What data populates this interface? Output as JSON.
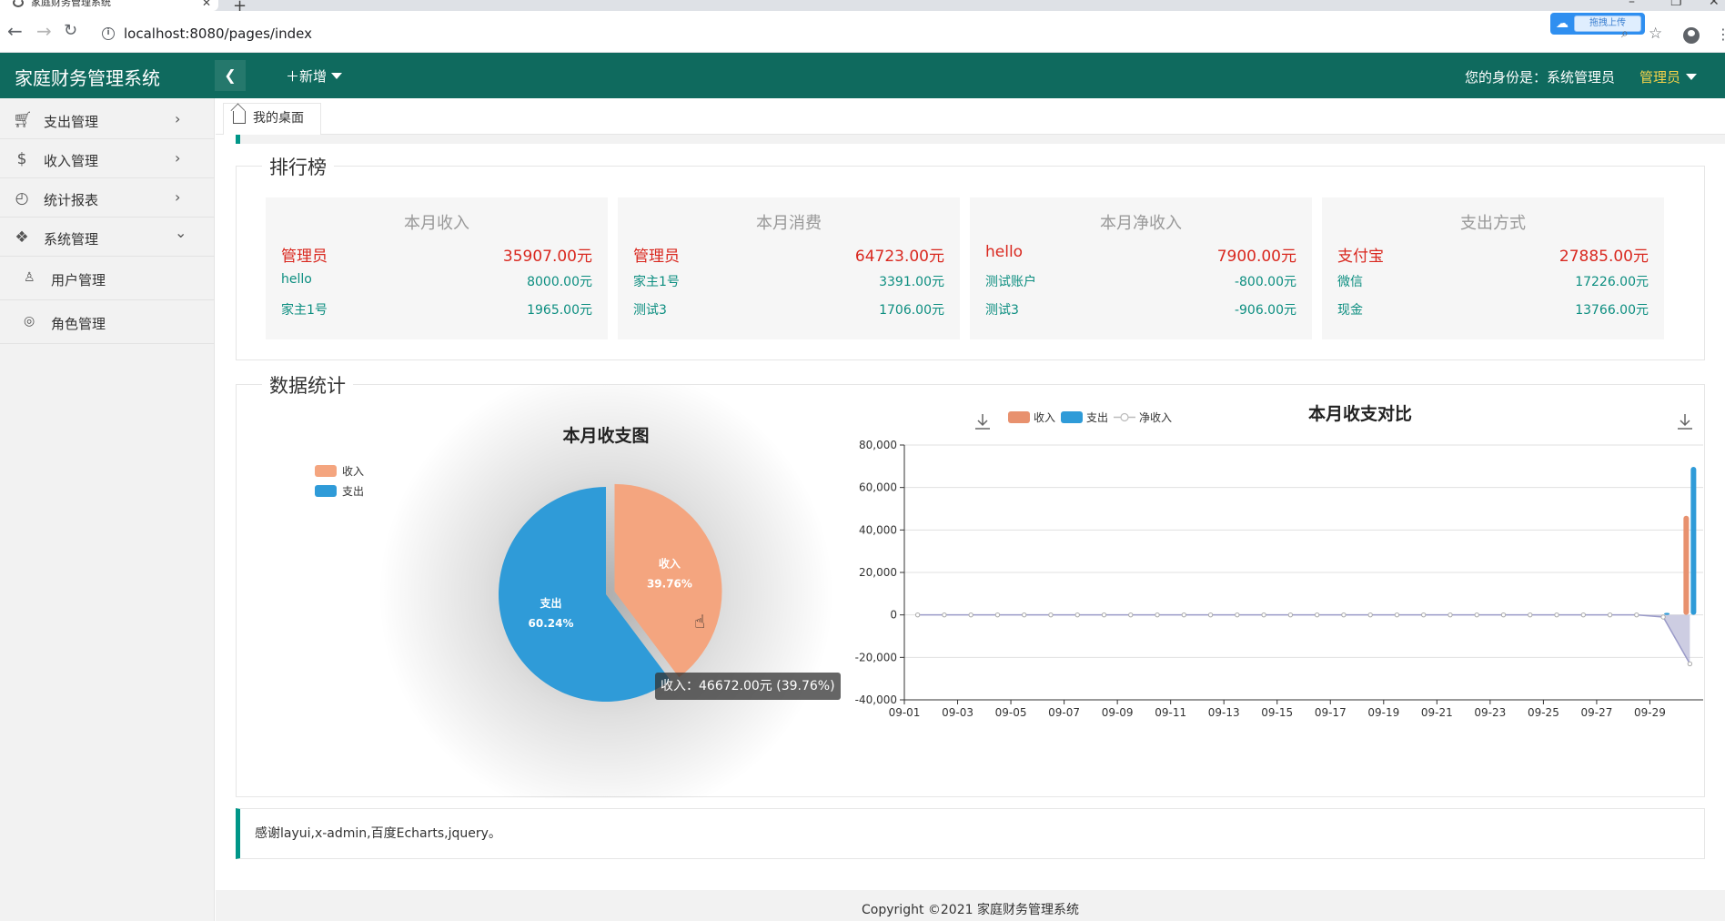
{
  "browser": {
    "tab_title": "家庭财务管理系统",
    "url": "localhost:8080/pages/index",
    "extension_label": "拖拽上传"
  },
  "header": {
    "logo": "家庭财务管理系统",
    "add_menu": "新增",
    "identity": "您的身份是：系统管理员",
    "role": "管理员"
  },
  "sidebar": {
    "items": [
      {
        "label": "支出管理",
        "icon": "cart-icon"
      },
      {
        "label": "收入管理",
        "icon": "dollar-icon"
      },
      {
        "label": "统计报表",
        "icon": "chart-line-icon"
      },
      {
        "label": "系统管理",
        "icon": "apps-icon"
      }
    ],
    "subitems": [
      {
        "label": "用户管理",
        "icon": "user-icon"
      },
      {
        "label": "角色管理",
        "icon": "role-icon"
      }
    ]
  },
  "tabs": {
    "desk": "我的桌面"
  },
  "ranking": {
    "legend": "排行榜",
    "cards": [
      {
        "title": "本月收入",
        "rows": [
          {
            "name": "管理员",
            "value": "35907.00元"
          },
          {
            "name": "hello",
            "value": "8000.00元"
          },
          {
            "name": "家主1号",
            "value": "1965.00元"
          }
        ]
      },
      {
        "title": "本月消费",
        "rows": [
          {
            "name": "管理员",
            "value": "64723.00元"
          },
          {
            "name": "家主1号",
            "value": "3391.00元"
          },
          {
            "name": "测试3",
            "value": "1706.00元"
          }
        ]
      },
      {
        "title": "本月净收入",
        "rows": [
          {
            "name": "hello",
            "value": "7900.00元"
          },
          {
            "name": "测试账户",
            "value": "-800.00元"
          },
          {
            "name": "测试3",
            "value": "-906.00元"
          }
        ]
      },
      {
        "title": "支出方式",
        "rows": [
          {
            "name": "支付宝",
            "value": "27885.00元"
          },
          {
            "name": "微信",
            "value": "17226.00元"
          },
          {
            "name": "现金",
            "value": "13766.00元"
          }
        ]
      }
    ]
  },
  "stats": {
    "legend": "数据统计"
  },
  "colors": {
    "income": "#f4a57f",
    "income_bar": "#e8916e",
    "expense": "#2f9bd8",
    "net": "#b8b8d6",
    "primary": "#0f6a5e",
    "accent": "#009688"
  },
  "chart_data": [
    {
      "type": "pie",
      "title": "本月收支图",
      "legend": [
        "收入",
        "支出"
      ],
      "slices": [
        {
          "name": "收入",
          "value": 46672.0,
          "percent": "39.76%"
        },
        {
          "name": "支出",
          "value": 70714.0,
          "percent": "60.24%"
        }
      ],
      "tooltip": "收入：46672.00元 (39.76%)",
      "legend_position": "top-left"
    },
    {
      "type": "bar",
      "title": "本月收支对比",
      "legend": [
        "收入",
        "支出",
        "净收入"
      ],
      "ylim": [
        -40000,
        80000
      ],
      "y_ticks": [
        "80,000",
        "60,000",
        "40,000",
        "20,000",
        "0",
        "-20,000",
        "-40,000"
      ],
      "x_tick_labels": [
        "09-01",
        "09-03",
        "09-05",
        "09-07",
        "09-09",
        "09-11",
        "09-13",
        "09-15",
        "09-17",
        "09-19",
        "09-21",
        "09-23",
        "09-25",
        "09-27",
        "09-29"
      ],
      "categories": [
        "09-01",
        "09-02",
        "09-03",
        "09-04",
        "09-05",
        "09-06",
        "09-07",
        "09-08",
        "09-09",
        "09-10",
        "09-11",
        "09-12",
        "09-13",
        "09-14",
        "09-15",
        "09-16",
        "09-17",
        "09-18",
        "09-19",
        "09-20",
        "09-21",
        "09-22",
        "09-23",
        "09-24",
        "09-25",
        "09-26",
        "09-27",
        "09-28",
        "09-29",
        "09-30"
      ],
      "series": [
        {
          "name": "收入",
          "type": "bar",
          "values": [
            0,
            0,
            0,
            0,
            0,
            0,
            0,
            0,
            0,
            0,
            0,
            0,
            0,
            0,
            0,
            0,
            0,
            0,
            0,
            0,
            0,
            0,
            0,
            0,
            0,
            0,
            0,
            0,
            0,
            46672
          ]
        },
        {
          "name": "支出",
          "type": "bar",
          "values": [
            0,
            0,
            0,
            0,
            0,
            0,
            0,
            0,
            0,
            0,
            0,
            0,
            0,
            0,
            0,
            0,
            0,
            0,
            0,
            0,
            0,
            0,
            0,
            0,
            0,
            0,
            0,
            0,
            1000,
            69714
          ]
        },
        {
          "name": "净收入",
          "type": "area",
          "values": [
            0,
            0,
            0,
            0,
            0,
            0,
            0,
            0,
            0,
            0,
            0,
            0,
            0,
            0,
            0,
            0,
            0,
            0,
            0,
            0,
            0,
            0,
            0,
            0,
            0,
            0,
            0,
            0,
            -1000,
            -23042
          ]
        }
      ],
      "grid": true,
      "legend_position": "top-left"
    }
  ],
  "footer": {
    "thanks": "感谢layui,x-admin,百度Echarts,jquery。",
    "copyright": "Copyright ©2021 家庭财务管理系统"
  }
}
